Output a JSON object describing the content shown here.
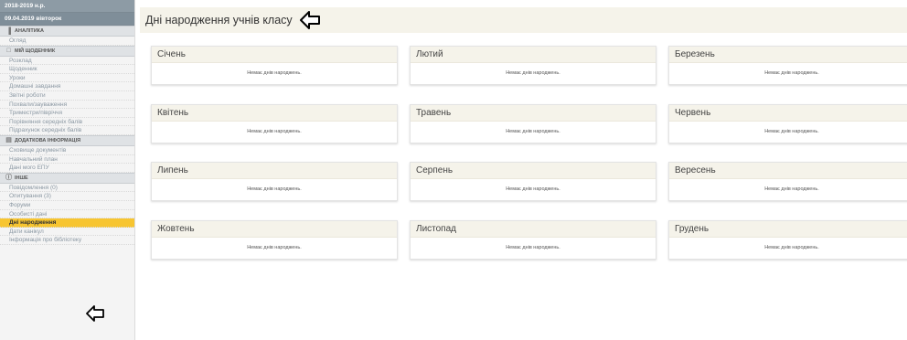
{
  "sidebar": {
    "year": "2018-2019 н.р.",
    "date": "09.04.2019 вівторок",
    "sections": [
      {
        "icon": "chart-icon",
        "title": "Аналітика",
        "items": [
          "Огляд"
        ]
      },
      {
        "icon": "diary-icon",
        "title": "Мій щоденник",
        "items": [
          "Розклад",
          "Щоденник",
          "Уроки",
          "Домашні завдання",
          "Звітні роботи",
          "Похвали/зауваження",
          "Триместри/півріччя",
          "Порівняння середніх балів",
          "Підрахунок середніх балів"
        ]
      },
      {
        "icon": "document-icon",
        "title": "Додаткова інформація",
        "items": [
          "Сховище документів",
          "Навчальний план",
          "Дані мого ЕПУ"
        ]
      },
      {
        "icon": "info-icon",
        "title": "Інше",
        "items": [
          "Повідомлення (0)",
          "Опитування (3)",
          "Форуми",
          "Особисті дані",
          "Дні народження",
          "Дати канікул",
          "Інформація про бібліотеку"
        ]
      }
    ],
    "active_item": "Дні народження"
  },
  "main": {
    "title": "Дні народження учнів класу",
    "empty_text": "Немає днів народжень.",
    "months": [
      "Січень",
      "Лютий",
      "Березень",
      "Квітень",
      "Травень",
      "Червень",
      "Липень",
      "Серпень",
      "Вересень",
      "Жовтень",
      "Листопад",
      "Грудень"
    ]
  },
  "colors": {
    "active_bg": "#f7c531",
    "sidebar_head": "#8d9ba5",
    "card_head": "#f5f3ea"
  }
}
